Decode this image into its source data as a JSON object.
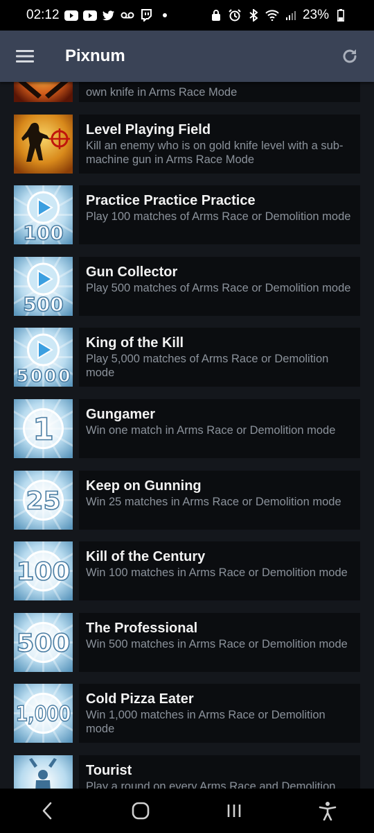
{
  "status": {
    "time": "02:12",
    "battery": "23%",
    "left_icons": [
      "youtube-icon",
      "youtube-icon",
      "twitter-icon",
      "voicemail-icon",
      "twitch-icon",
      "dot-icon"
    ],
    "right_icons": [
      "lock-icon",
      "alarm-icon",
      "bluetooth-icon",
      "wifi-icon",
      "signal-icon",
      "battery-icon"
    ]
  },
  "app_bar": {
    "title": "Pixnum",
    "menu_icon": "hamburger-menu-icon",
    "refresh_icon": "refresh-icon"
  },
  "achievements": [
    {
      "title": "",
      "description": "own knife in Arms Race Mode",
      "badge": "knife-badge"
    },
    {
      "title": "Level Playing Field",
      "description": "Kill an enemy who is on gold knife level with a sub-machine gun in Arms Race Mode",
      "badge": "soldier-badge"
    },
    {
      "title": "Practice Practice Practice",
      "description": "Play 100 matches of Arms Race or Demolition mode",
      "badge": "play",
      "badge_text": "100"
    },
    {
      "title": "Gun Collector",
      "description": "Play 500 matches of Arms Race or Demolition mode",
      "badge": "play",
      "badge_text": "500"
    },
    {
      "title": "King of the Kill",
      "description": "Play 5,000 matches of Arms Race or Demolition mode",
      "badge": "play",
      "badge_text": "5000"
    },
    {
      "title": "Gungamer",
      "description": "Win one match in Arms Race or Demolition mode",
      "badge": "burst",
      "badge_text": "1"
    },
    {
      "title": "Keep on Gunning",
      "description": "Win 25 matches in Arms Race or Demolition mode",
      "badge": "burst",
      "badge_text": "25"
    },
    {
      "title": "Kill of the Century",
      "description": "Win 100 matches in Arms Race or Demolition mode",
      "badge": "burst",
      "badge_text": "100"
    },
    {
      "title": "The Professional",
      "description": "Win 500 matches in Arms Race or Demolition mode",
      "badge": "burst",
      "badge_text": "500"
    },
    {
      "title": "Cold Pizza Eater",
      "description": "Win 1,000 matches in Arms Race or Demolition mode",
      "badge": "burst",
      "badge_text": "1,000"
    },
    {
      "title": "Tourist",
      "description": "Play a round on every Arms Race and Demolition map",
      "badge": "tourist-badge"
    }
  ],
  "nav": {
    "back_icon": "back-icon",
    "home_icon": "home-icon",
    "recents_icon": "recents-icon",
    "accessibility_icon": "accessibility-icon"
  },
  "colors": {
    "app_bar": "#3a4356",
    "list_bg": "#14171c",
    "card_bg": "#0b0d10",
    "title_text": "#f2f2f2",
    "desc_text": "#8b929b"
  }
}
